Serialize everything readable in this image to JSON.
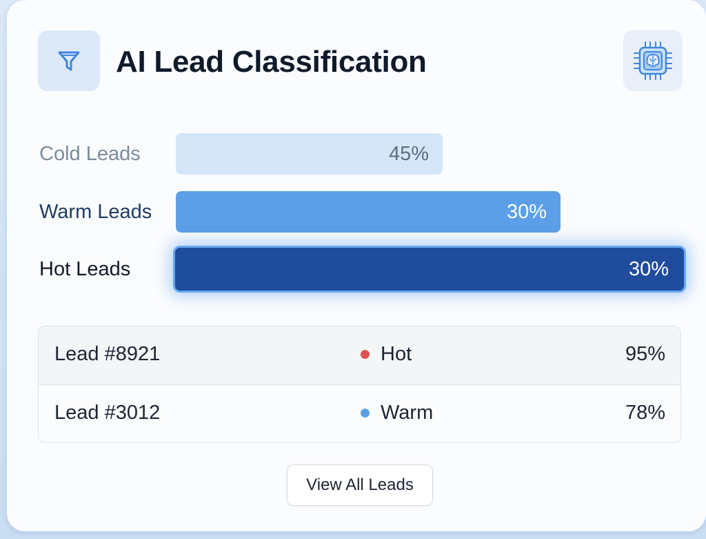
{
  "header": {
    "title": "AI Lead Classification",
    "left_icon": "funnel-icon",
    "right_icon": "ai-chip-icon"
  },
  "classification": {
    "bars": [
      {
        "label": "Cold Leads",
        "value_label": "45%",
        "value": 45,
        "color": "#d6e6f9"
      },
      {
        "label": "Warm Leads",
        "value_label": "30%",
        "value": 30,
        "color": "#5b9fe8"
      },
      {
        "label": "Hot Leads",
        "value_label": "30%",
        "value": 30,
        "color": "#1f4c9c"
      }
    ]
  },
  "leads": [
    {
      "id": "Lead #8921",
      "status": "Hot",
      "status_color": "#e05252",
      "score": "95%"
    },
    {
      "id": "Lead #3012",
      "status": "Warm",
      "status_color": "#5a9fe6",
      "score": "78%"
    }
  ],
  "actions": {
    "view_all_label": "View All Leads"
  }
}
